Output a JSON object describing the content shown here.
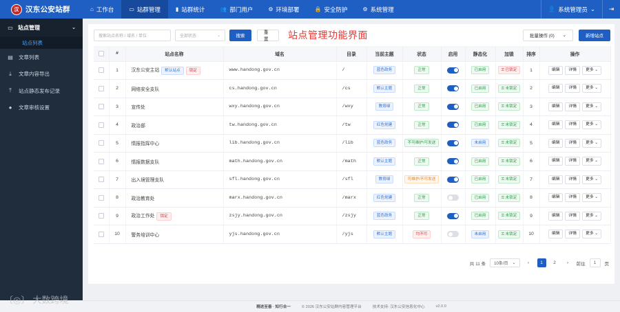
{
  "app": {
    "title": "汉东公安站群",
    "logo_char": "汉"
  },
  "nav": [
    {
      "label": "工作台",
      "icon": "home-icon",
      "glyph": "⌂"
    },
    {
      "label": "站群管理",
      "icon": "monitor-icon",
      "glyph": "▭",
      "active": true
    },
    {
      "label": "站群统计",
      "icon": "bar-chart-icon",
      "glyph": "▮"
    },
    {
      "label": "部门用户",
      "icon": "users-icon",
      "glyph": "👥"
    },
    {
      "label": "环境部署",
      "icon": "gear-icon",
      "glyph": "⚙"
    },
    {
      "label": "安全防护",
      "icon": "lock-icon",
      "glyph": "🔒"
    },
    {
      "label": "系统管理",
      "icon": "settings-icon",
      "glyph": "⚙"
    }
  ],
  "user": {
    "name": "系统管理员",
    "caret": "⌄"
  },
  "sidebar": {
    "group": {
      "label": "站点管理",
      "sub": "站点列表"
    },
    "items": [
      {
        "label": "文章列表",
        "icon": "document-icon",
        "glyph": "▤"
      },
      {
        "label": "文章内容导出",
        "icon": "download-icon",
        "glyph": "⤓"
      },
      {
        "label": "站点静态发布记录",
        "icon": "upload-icon",
        "glyph": "⤒"
      },
      {
        "label": "文章审核设置",
        "icon": "user-icon",
        "glyph": "●"
      }
    ]
  },
  "toolbar": {
    "search_placeholder": "搜索站点名称 / 域名 / 单位",
    "status_placeholder": "全部状态",
    "search_btn": "搜索",
    "reset_btn": "重置",
    "page_title": "站点管理功能界面",
    "batch_label": "批量操作 (0)",
    "new_btn": "新增站点"
  },
  "table": {
    "headers": [
      "#",
      "站点名称",
      "域名",
      "目录",
      "当前主题",
      "状态",
      "启用",
      "静态化",
      "加锁",
      "排序",
      "操作"
    ],
    "rows": [
      {
        "no": "1",
        "name": "汉东公安主站",
        "tags": [
          {
            "text": "默认站点",
            "c": "blue"
          },
          {
            "text": "锁定",
            "c": "red"
          }
        ],
        "domain": "www.handong.gov.cn",
        "dir": "/",
        "theme": "蓝色政务",
        "theme_c": "blue",
        "status": "正常",
        "status_c": "green",
        "enabled": true,
        "static": "已启用",
        "static_c": "green",
        "lock": "已锁定",
        "lock_c": "red",
        "sort": "1"
      },
      {
        "no": "2",
        "name": "网络安全支队",
        "tags": [],
        "domain": "cs.handong.gov.cn",
        "dir": "/cs",
        "theme": "默认主题",
        "theme_c": "blue",
        "status": "正常",
        "status_c": "green",
        "enabled": true,
        "static": "已启用",
        "static_c": "green",
        "lock": "未锁定",
        "lock_c": "green",
        "sort": "2"
      },
      {
        "no": "3",
        "name": "宣传处",
        "tags": [],
        "domain": "wxy.handong.gov.cn",
        "dir": "/wxy",
        "theme": "教育绿",
        "theme_c": "blue",
        "status": "正常",
        "status_c": "green",
        "enabled": true,
        "static": "已启用",
        "static_c": "green",
        "lock": "未锁定",
        "lock_c": "green",
        "sort": "3"
      },
      {
        "no": "4",
        "name": "政治部",
        "tags": [],
        "domain": "tw.handong.gov.cn",
        "dir": "/tw",
        "theme": "红色党建",
        "theme_c": "blue",
        "status": "正常",
        "status_c": "green",
        "enabled": true,
        "static": "已启用",
        "static_c": "green",
        "lock": "未锁定",
        "lock_c": "green",
        "sort": "4"
      },
      {
        "no": "5",
        "name": "情报指挥中心",
        "tags": [],
        "domain": "lib.handong.gov.cn",
        "dir": "/lib",
        "theme": "蓝色政务",
        "theme_c": "blue",
        "status": "不可维护/可发送",
        "status_c": "green",
        "enabled": true,
        "static": "未启用",
        "static_c": "blue",
        "lock": "未锁定",
        "lock_c": "green",
        "sort": "5"
      },
      {
        "no": "6",
        "name": "情报数据支队",
        "tags": [],
        "domain": "math.handong.gov.cn",
        "dir": "/math",
        "theme": "默认主题",
        "theme_c": "blue",
        "status": "正常",
        "status_c": "green",
        "enabled": true,
        "static": "已启用",
        "static_c": "green",
        "lock": "未锁定",
        "lock_c": "green",
        "sort": "6"
      },
      {
        "no": "7",
        "name": "出入境管理支队",
        "tags": [],
        "domain": "sfl.handong.gov.cn",
        "dir": "/sfl",
        "theme": "教育绿",
        "theme_c": "blue",
        "status": "可维护/不可发送",
        "status_c": "orange",
        "enabled": true,
        "static": "已启用",
        "static_c": "green",
        "lock": "未锁定",
        "lock_c": "green",
        "sort": "7"
      },
      {
        "no": "8",
        "name": "政治教育处",
        "tags": [],
        "domain": "marx.handong.gov.cn",
        "dir": "/marx",
        "theme": "红色党建",
        "theme_c": "blue",
        "status": "正常",
        "status_c": "green",
        "enabled": false,
        "static": "已启用",
        "static_c": "green",
        "lock": "未锁定",
        "lock_c": "green",
        "sort": "8"
      },
      {
        "no": "9",
        "name": "政治工作处",
        "tags": [
          {
            "text": "锁定",
            "c": "red"
          }
        ],
        "domain": "zsjy.handong.gov.cn",
        "dir": "/zsjy",
        "theme": "蓝色政务",
        "theme_c": "blue",
        "status": "正常",
        "status_c": "green",
        "enabled": true,
        "static": "已启用",
        "static_c": "green",
        "lock": "未锁定",
        "lock_c": "green",
        "sort": "9"
      },
      {
        "no": "10",
        "name": "警务培训中心",
        "tags": [],
        "domain": "yjs.handong.gov.cn",
        "dir": "/yjs",
        "theme": "默认主题",
        "theme_c": "blue",
        "status": "均不可",
        "status_c": "red",
        "enabled": false,
        "static": "未启用",
        "static_c": "blue",
        "lock": "未锁定",
        "lock_c": "green",
        "sort": "10"
      }
    ],
    "ops": {
      "edit": "编辑",
      "detail": "详情",
      "more": "更多"
    }
  },
  "pagination": {
    "total": "共 11 条",
    "page_size": "10条/页",
    "pages": [
      "1",
      "2"
    ],
    "current": "1",
    "goto": "前往",
    "goto_value": "1",
    "unit": "页"
  },
  "footer": {
    "slogan": "精进至善 · 知行合一",
    "copyright": "© 2026 汉东公安站群内容管理平台",
    "support": "技术支持: 汉东公安信息化中心",
    "version": "v2.0.0"
  },
  "watermark": "大数跨境",
  "colors": {
    "primary": "#1f5fc4",
    "sidebar": "#1f2d3d",
    "accent_red": "#e53935"
  }
}
